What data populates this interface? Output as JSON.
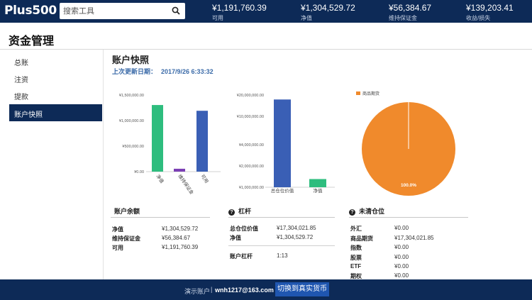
{
  "topbar": {
    "logo": "Plus500",
    "search_placeholder": "搜索工具",
    "stats": [
      {
        "value": "¥1,191,760.39",
        "label": "可用"
      },
      {
        "value": "¥1,304,529.72",
        "label": "净值"
      },
      {
        "value": "¥56,384.67",
        "label": "维持保证金"
      },
      {
        "value": "¥139,203.41",
        "label": "收益/损失"
      }
    ]
  },
  "page_title": "资金管理",
  "sidebar": {
    "items": [
      {
        "label": "总账"
      },
      {
        "label": "注资"
      },
      {
        "label": "提款"
      },
      {
        "label": "账户快照"
      }
    ]
  },
  "snapshot": {
    "title": "账户快照",
    "updated_label": "上次更新日期：",
    "updated_value": "2017/9/26 6:33:32"
  },
  "colors": {
    "navy": "#0d2a57",
    "green": "#2ebd7e",
    "purple": "#7b3fb4",
    "blue": "#3a5fb5",
    "orange": "#f08a2c",
    "button": "#1f56b0"
  },
  "chart_data": [
    {
      "type": "bar",
      "categories": [
        "净值",
        "维持保证金",
        "可用"
      ],
      "values": [
        1304529.72,
        56384.67,
        1191760.39
      ],
      "colors": [
        "#2ebd7e",
        "#7b3fb4",
        "#3a5fb5"
      ],
      "yticks": [
        "¥1,500,000.00",
        "¥1,000,000.00",
        "¥500,000.00",
        "¥0.00"
      ],
      "ylim": [
        0,
        1500000
      ]
    },
    {
      "type": "bar",
      "scale": "log",
      "categories": [
        "总仓位价值",
        "净值"
      ],
      "values": [
        17304021.85,
        1304529.72
      ],
      "colors": [
        "#3a5fb5",
        "#2ebd7e"
      ],
      "yticks": [
        "¥20,000,000.00",
        "¥10,000,000.00",
        "¥4,000,000.00",
        "¥2,000,000.00",
        "¥1,000,000.00"
      ],
      "ylim": [
        1000000,
        20000000
      ]
    },
    {
      "type": "pie",
      "legend": [
        "商品期货"
      ],
      "values": [
        100
      ],
      "colors": [
        "#f08a2c"
      ],
      "data_labels": [
        "100.0%"
      ]
    }
  ],
  "balance_panel": {
    "title": "账户余额",
    "rows": [
      {
        "label": "净值",
        "value": "¥1,304,529.72"
      },
      {
        "label": "维持保证金",
        "value": "¥56,384.67"
      },
      {
        "label": "可用",
        "value": "¥1,191,760.39"
      }
    ]
  },
  "leverage_panel": {
    "title": "杠杆",
    "rows": [
      {
        "label": "总仓位价值",
        "value": "¥17,304,021.85"
      },
      {
        "label": "净值",
        "value": "¥1,304,529.72"
      }
    ],
    "leverage_label": "账户杠杆",
    "leverage_value": "1:13"
  },
  "positions_panel": {
    "title": "未清仓位",
    "rows": [
      {
        "label": "外汇",
        "value": "¥0.00"
      },
      {
        "label": "商品期货",
        "value": "¥17,304,021.85"
      },
      {
        "label": "指数",
        "value": "¥0.00"
      },
      {
        "label": "股票",
        "value": "¥0.00"
      },
      {
        "label": "ETF",
        "value": "¥0.00"
      },
      {
        "label": "期权",
        "value": "¥0.00"
      }
    ]
  },
  "footer": {
    "demo_label": "演示账户",
    "separator": "|",
    "email": "wnh1217@163.com",
    "switch_button": "切换到真实货币"
  }
}
